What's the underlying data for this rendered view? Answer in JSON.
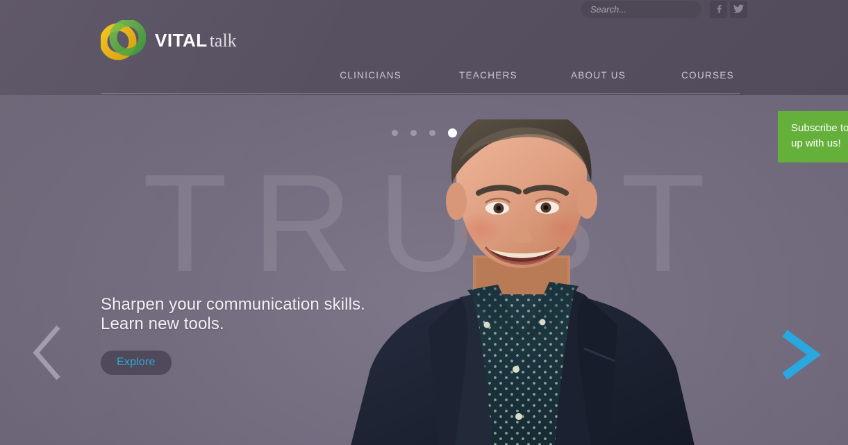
{
  "site": {
    "logo_primary": "VITAL",
    "logo_secondary": "talk",
    "logo_mark": "two-interlocking-rings-gold-green"
  },
  "header": {
    "search": {
      "placeholder": "Search...",
      "value": ""
    },
    "social": [
      {
        "name": "facebook-icon",
        "label": "f"
      },
      {
        "name": "twitter-icon",
        "label": "t"
      }
    ],
    "nav": [
      {
        "label": "CLINICIANS"
      },
      {
        "label": "TEACHERS"
      },
      {
        "label": "ABOUT US"
      },
      {
        "label": "COURSES"
      }
    ]
  },
  "hero": {
    "watermark": "TRUST",
    "caption_line1": "Sharpen your communication skills.",
    "caption_line2": "Learn new tools.",
    "cta_label": "Explore",
    "prev_label": "‹",
    "next_label": "›",
    "slides": [
      {
        "active": false
      },
      {
        "active": false
      },
      {
        "active": false
      },
      {
        "active": true
      }
    ],
    "active_slide_index": 4,
    "slide_count": 4
  },
  "subscribe": {
    "line1": "Subscribe to k",
    "line2": "up with us!"
  },
  "colors": {
    "header_bg": "#565060",
    "hero_bg": "#756e80",
    "accent_blue": "#2fa8e0",
    "subscribe_green": "#64b03a",
    "logo_gold": "#e8b31d",
    "logo_green": "#5fae46",
    "text_light": "#f2eff4",
    "nav_text": "#cdc7d4"
  }
}
